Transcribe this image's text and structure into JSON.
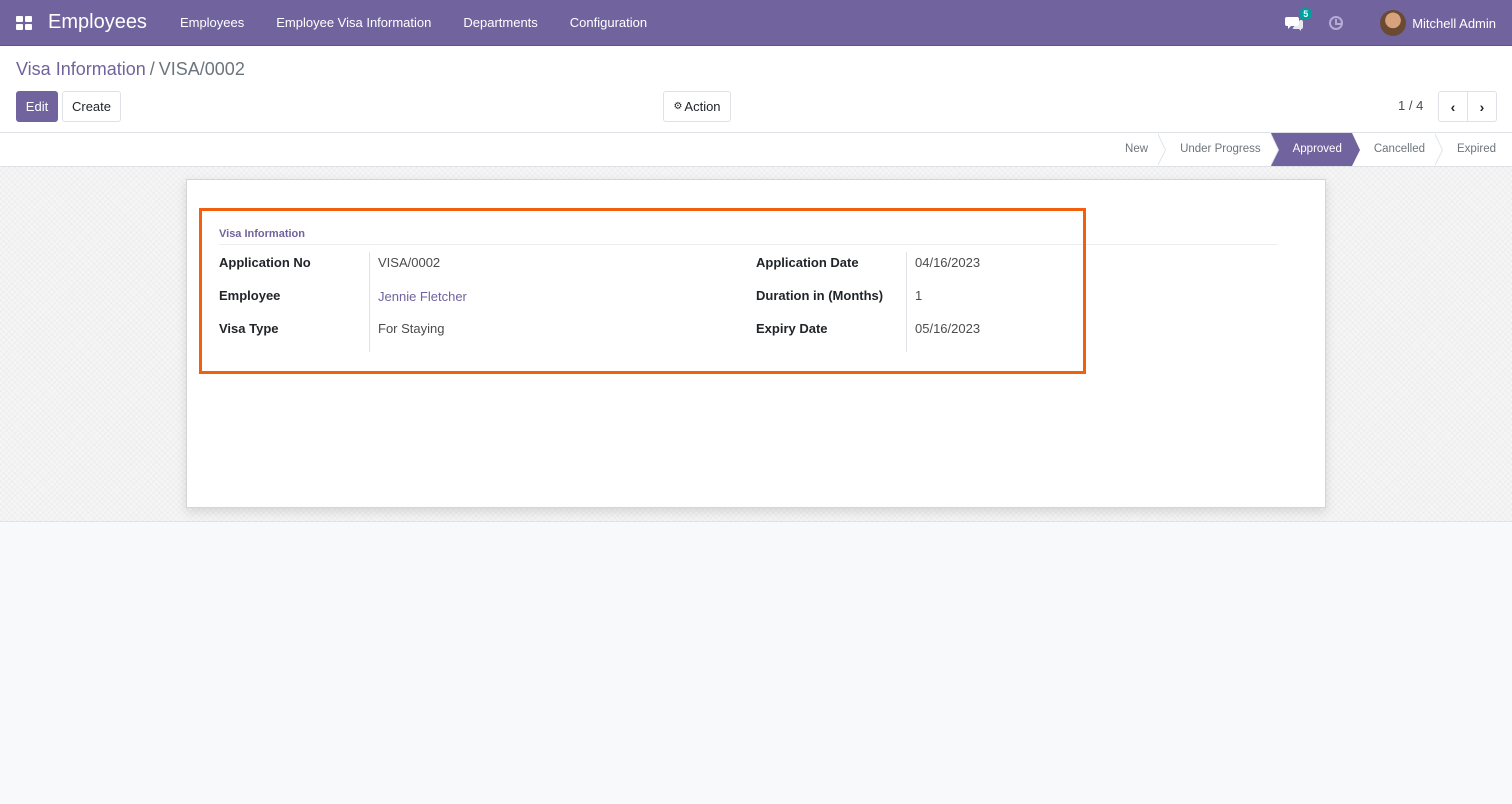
{
  "navbar": {
    "app_name": "Employees",
    "menu": [
      "Employees",
      "Employee Visa Information",
      "Departments",
      "Configuration"
    ],
    "messages_count": "5",
    "user_name": "Mitchell Admin"
  },
  "breadcrumb": {
    "parent": "Visa Information",
    "separator": "/",
    "current": "VISA/0002"
  },
  "buttons": {
    "edit": "Edit",
    "create": "Create",
    "action": "Action"
  },
  "pager": {
    "value": "1 / 4"
  },
  "statusbar": {
    "stages": [
      "New",
      "Under Progress",
      "Approved",
      "Cancelled",
      "Expired"
    ],
    "active": "Approved"
  },
  "form": {
    "group_title": "Visa Information",
    "application_no_label": "Application No",
    "application_no": "VISA/0002",
    "employee_label": "Employee",
    "employee": "Jennie Fletcher",
    "visa_type_label": "Visa Type",
    "visa_type": "For Staying",
    "application_date_label": "Application Date",
    "application_date": "04/16/2023",
    "duration_label": "Duration in (Months)",
    "duration": "1",
    "expiry_date_label": "Expiry Date",
    "expiry_date": "05/16/2023"
  },
  "colors": {
    "brand": "#71639e",
    "highlight": "#f25f0f"
  }
}
